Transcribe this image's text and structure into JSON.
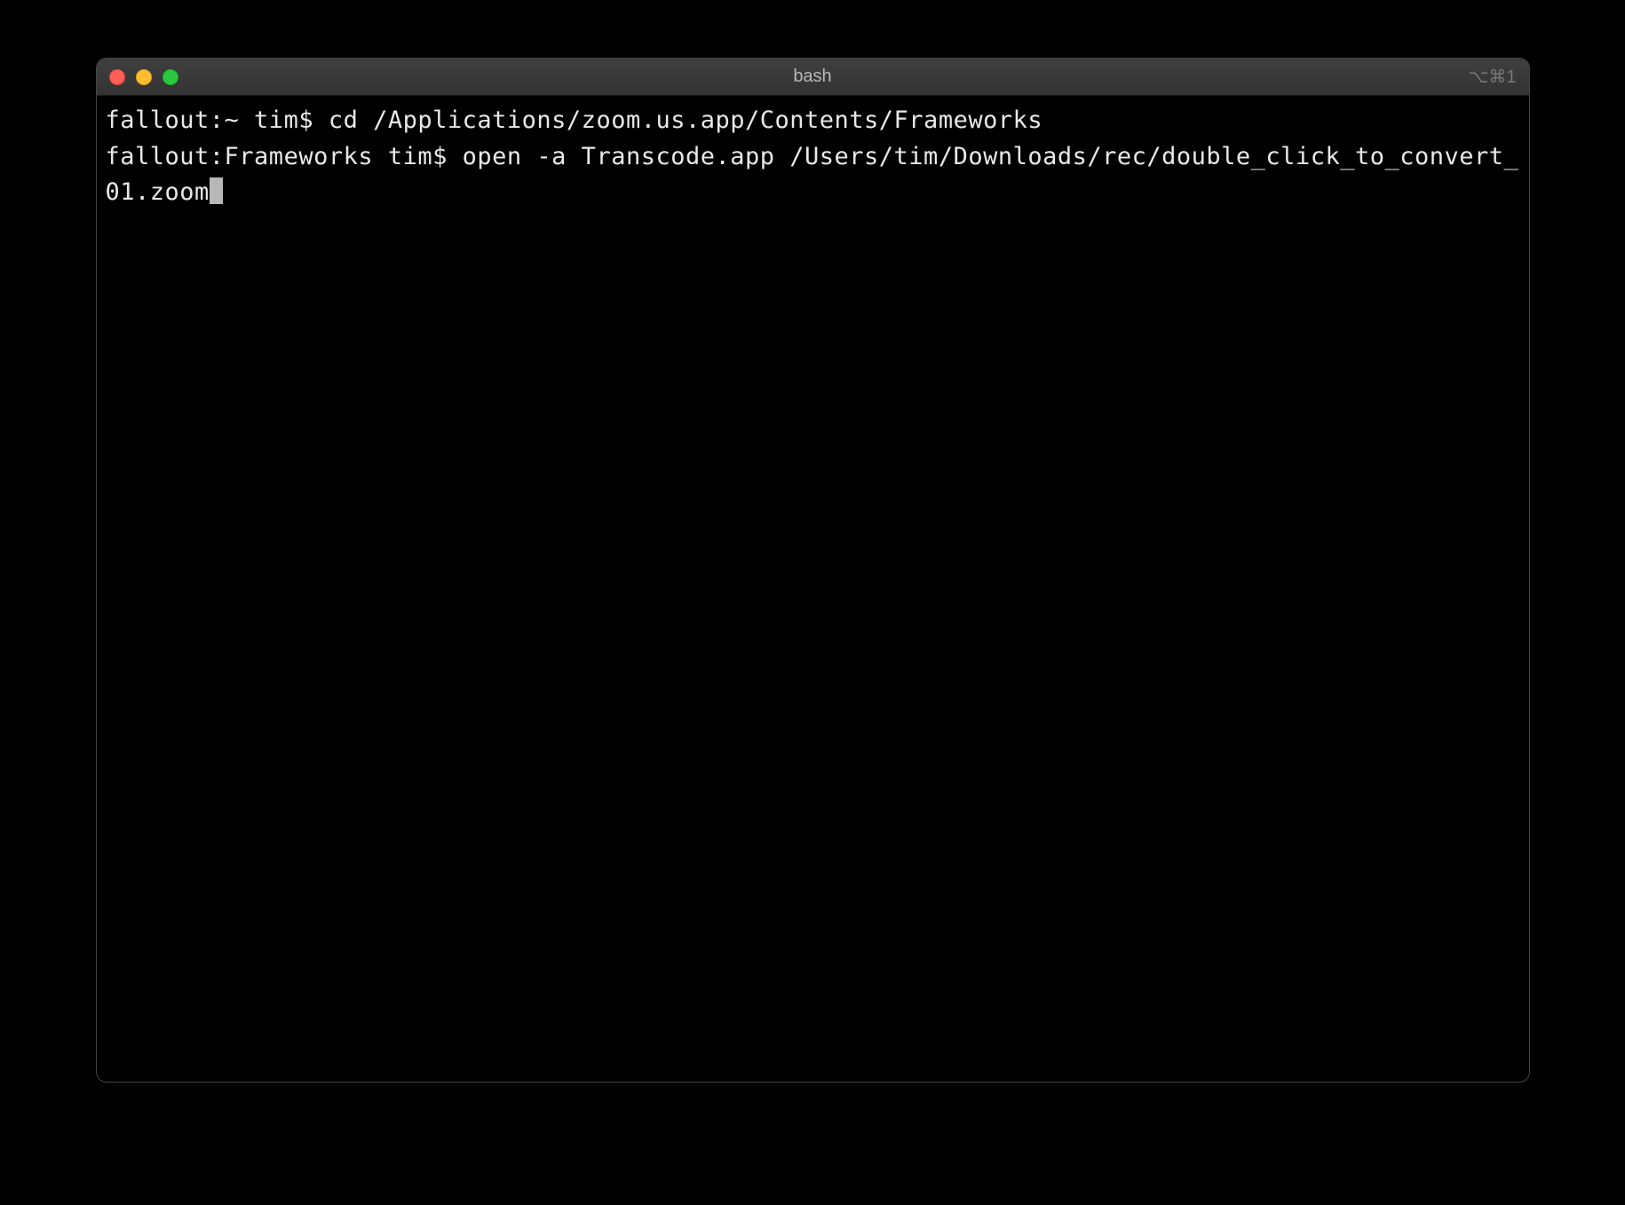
{
  "window": {
    "title": "bash",
    "shortcut": "⌥⌘1"
  },
  "terminal": {
    "lines": [
      {
        "prompt": "fallout:~ tim$ ",
        "command": "cd /Applications/zoom.us.app/Contents/Frameworks"
      },
      {
        "prompt": "fallout:Frameworks tim$ ",
        "command": "open -a Transcode.app /Users/tim/Downloads/rec/double_click_to_convert_01.zoom"
      }
    ]
  }
}
